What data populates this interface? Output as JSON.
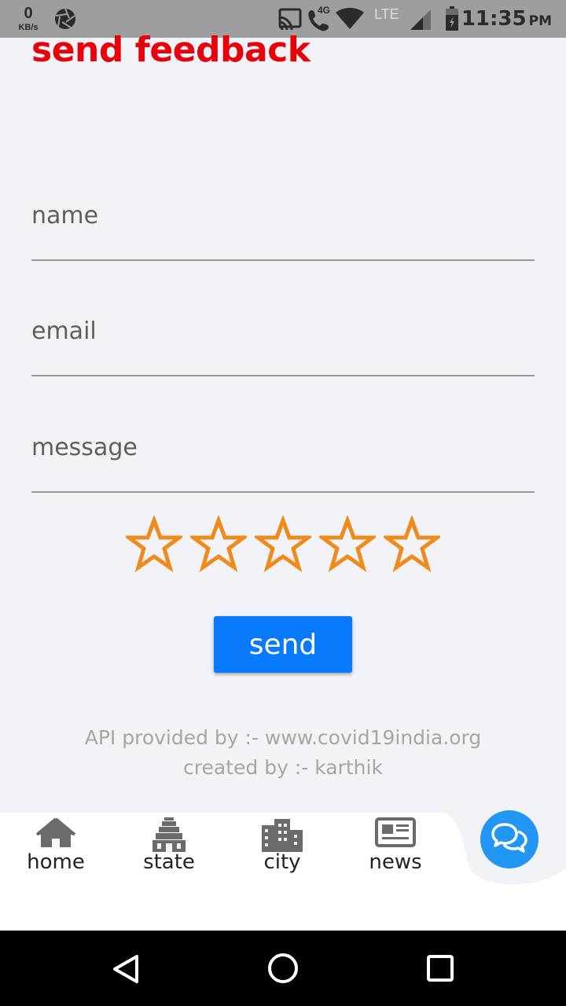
{
  "status_bar": {
    "speed_value": "0",
    "speed_unit": "KB/s",
    "network_4g": "4G",
    "network_lte": "LTE",
    "time": "11:35",
    "ampm": "PM",
    "icons": [
      "aperture-icon",
      "cast-icon",
      "call-4g-icon",
      "wifi-icon",
      "signal-icon",
      "battery-icon"
    ]
  },
  "page": {
    "title": "send feedback"
  },
  "form": {
    "name_placeholder": "name",
    "email_placeholder": "email",
    "message_placeholder": "message",
    "rating": {
      "max": 5,
      "value": 0
    },
    "send_label": "send"
  },
  "credits": {
    "api_line": "API provided by :- www.covid19india.org",
    "author_line": "created by :- karthik"
  },
  "bottom_nav": {
    "items": [
      {
        "label": "home",
        "icon": "home-icon"
      },
      {
        "label": "state",
        "icon": "temple-icon"
      },
      {
        "label": "city",
        "icon": "city-icon"
      },
      {
        "label": "news",
        "icon": "newspaper-icon"
      }
    ],
    "fab_icon": "chat-icon"
  },
  "colors": {
    "title_red": "#e8000b",
    "button_blue": "#0a7afc",
    "star_orange": "#f08a1c",
    "fab_blue": "#2196f3",
    "background": "#f2f3f7"
  }
}
